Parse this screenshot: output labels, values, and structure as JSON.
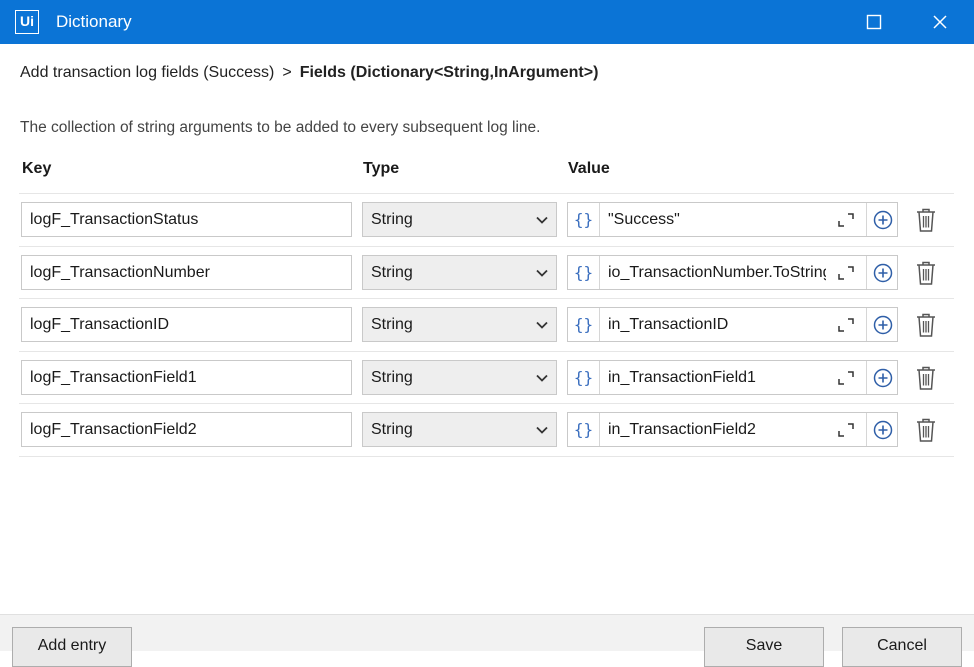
{
  "window": {
    "title": "Dictionary",
    "logo_text": "Ui"
  },
  "breadcrumb": {
    "parent": "Add transaction log fields (Success)",
    "separator": ">",
    "current": "Fields (Dictionary<String,InArgument>)"
  },
  "description": "The collection of string arguments to be added to every subsequent log line.",
  "columns": {
    "key": "Key",
    "type": "Type",
    "value": "Value"
  },
  "entries": [
    {
      "key": "logF_TransactionStatus",
      "type": "String",
      "value": "\"Success\""
    },
    {
      "key": "logF_TransactionNumber",
      "type": "String",
      "value": "io_TransactionNumber.ToString"
    },
    {
      "key": "logF_TransactionID",
      "type": "String",
      "value": "in_TransactionID"
    },
    {
      "key": "logF_TransactionField1",
      "type": "String",
      "value": "in_TransactionField1"
    },
    {
      "key": "logF_TransactionField2",
      "type": "String",
      "value": "in_TransactionField2"
    }
  ],
  "icons": {
    "brace": "{}",
    "expand": "expand-icon",
    "add": "plus-circle-icon",
    "delete": "trash-icon"
  },
  "footer": {
    "add_entry": "Add entry",
    "save": "Save",
    "cancel": "Cancel"
  },
  "colors": {
    "titlebar": "#0b74d6",
    "brace": "#3b6fbf"
  }
}
